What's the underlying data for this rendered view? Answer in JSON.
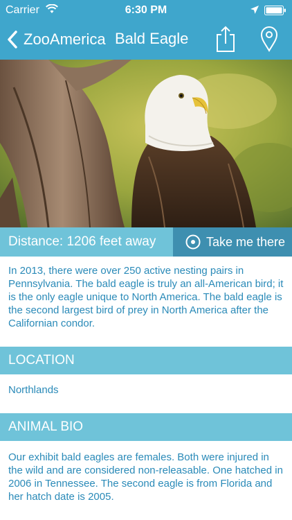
{
  "status_bar": {
    "carrier": "Carrier",
    "time": "6:30 PM"
  },
  "nav": {
    "back_label": "ZooAmerica",
    "title": "Bald Eagle"
  },
  "action_bar": {
    "distance": "Distance: 1206 feet away",
    "take_me_label": "Take me there"
  },
  "intro_text": "In 2013, there were over 250 active nesting pairs in Pennsylvania. The bald eagle is truly an all-American bird; it is the only eagle unique to North America. The bald eagle is the second largest bird of prey in North America after the Californian condor.",
  "location": {
    "header": "LOCATION",
    "value": "Northlands"
  },
  "animal_bio": {
    "header": "ANIMAL BIO",
    "text": "Our exhibit bald eagles are females. Both were injured in the wild and are considered non-releasable. One hatched in 2006 in Tennessee. The second eagle is from Florida and her hatch date is 2005."
  },
  "colors": {
    "nav_bar": "#3fa6cc",
    "section_header": "#6fc3d9",
    "take_me_button": "#3e8fb0",
    "body_text": "#2a8ab8"
  },
  "icons": [
    "wifi-icon",
    "location-arrow-icon",
    "battery-icon",
    "chevron-left-icon",
    "share-icon",
    "map-pin-icon",
    "target-icon"
  ]
}
